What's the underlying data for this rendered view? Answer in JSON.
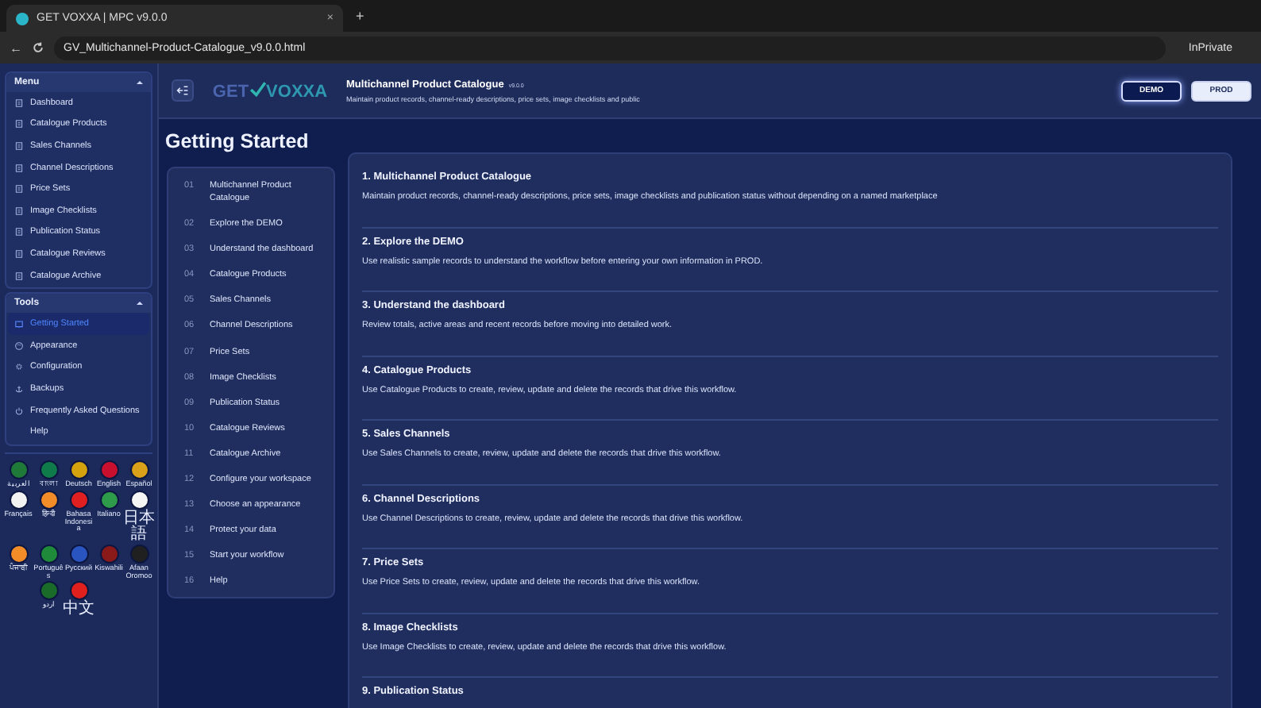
{
  "browser": {
    "tab_title": "GET VOXXA | MPC v9.0.0",
    "tab_close": "×",
    "new_tab": "+",
    "back": "←",
    "url": "GV_Multichannel-Product-Catalogue_v9.0.0.html",
    "profile": "InPrivate"
  },
  "sidebar": {
    "sections": [
      {
        "title": "Menu",
        "expanded": true,
        "items": [
          {
            "label": "Dashboard",
            "selected": false,
            "kind": "record"
          },
          {
            "label": "Catalogue Products",
            "selected": false,
            "kind": "record"
          },
          {
            "label": "Sales Channels",
            "selected": false,
            "kind": "record"
          },
          {
            "label": "Channel Descriptions",
            "selected": false,
            "kind": "record"
          },
          {
            "label": "Price Sets",
            "selected": false,
            "kind": "record"
          },
          {
            "label": "Image Checklists",
            "selected": false,
            "kind": "record"
          },
          {
            "label": "Publication Status",
            "selected": false,
            "kind": "record"
          },
          {
            "label": "Catalogue Reviews",
            "selected": false,
            "kind": "record"
          },
          {
            "label": "Catalogue Archive",
            "selected": false,
            "kind": "record"
          }
        ]
      },
      {
        "title": "Tools",
        "expanded": true,
        "items": [
          {
            "label": "Getting Started",
            "selected": true,
            "kind": "guide"
          },
          {
            "label": "Appearance",
            "selected": false,
            "kind": "appearance"
          },
          {
            "label": "Configuration",
            "selected": false,
            "kind": "configuration"
          },
          {
            "label": "Backups",
            "selected": false,
            "kind": "backup"
          },
          {
            "label": "Frequently Asked Questions",
            "selected": false,
            "kind": "faq"
          },
          {
            "label": "Help",
            "selected": false,
            "kind": "help"
          }
        ]
      }
    ],
    "languages": [
      {
        "label": "العربية",
        "color": "#1f7a3a"
      },
      {
        "label": "বাংলা",
        "color": "#0f7a4a"
      },
      {
        "label": "Deutsch",
        "color": "#d4a20c"
      },
      {
        "label": "English",
        "color": "#c8102e"
      },
      {
        "label": "Español",
        "color": "#d9a019"
      },
      {
        "label": "Français",
        "color": "#f2f2f2"
      },
      {
        "label": "हिन्दी",
        "color": "#f28c28"
      },
      {
        "label": "Bahasa Indonesia",
        "color": "#e02020"
      },
      {
        "label": "Italiano",
        "color": "#2e9b4a"
      },
      {
        "label": "日本語",
        "color": "#f5f5f5"
      },
      {
        "label": "ਪੰਜਾਬੀ",
        "color": "#f28c28"
      },
      {
        "label": "Português",
        "color": "#1f8a3a"
      },
      {
        "label": "Русский",
        "color": "#2a55c0"
      },
      {
        "label": "Kiswahili",
        "color": "#8a1a1a"
      },
      {
        "label": "Afaan Oromoo",
        "color": "#202020"
      },
      {
        "label": "اردو",
        "color": "#1a6a2a"
      },
      {
        "label": "中文",
        "color": "#e0201c"
      }
    ]
  },
  "header": {
    "logo_prefix": "GET",
    "logo_name": "VOXXA",
    "title": "Multichannel Product Catalogue",
    "version": "v9.0.0",
    "subtitle": "Maintain product records, channel-ready descriptions, price sets, image checklists and public",
    "modes": [
      {
        "label": "DEMO",
        "selected": true
      },
      {
        "label": "PROD",
        "selected": false
      }
    ]
  },
  "page_title": "Getting Started",
  "contents": [
    {
      "number": "01",
      "label": "Multichannel Product Catalogue"
    },
    {
      "number": "02",
      "label": "Explore the DEMO"
    },
    {
      "number": "03",
      "label": "Understand the dashboard"
    },
    {
      "number": "04",
      "label": "Catalogue Products"
    },
    {
      "number": "05",
      "label": "Sales Channels"
    },
    {
      "number": "06",
      "label": "Channel Descriptions"
    },
    {
      "number": "07",
      "label": "Price Sets"
    },
    {
      "number": "08",
      "label": "Image Checklists"
    },
    {
      "number": "09",
      "label": "Publication Status"
    },
    {
      "number": "10",
      "label": "Catalogue Reviews"
    },
    {
      "number": "11",
      "label": "Catalogue Archive"
    },
    {
      "number": "12",
      "label": "Configure your workspace"
    },
    {
      "number": "13",
      "label": "Choose an appearance"
    },
    {
      "number": "14",
      "label": "Protect your data"
    },
    {
      "number": "15",
      "label": "Start your workflow"
    },
    {
      "number": "16",
      "label": "Help"
    }
  ],
  "sections": [
    {
      "title": "1. Multichannel Product Catalogue",
      "text": "Maintain product records, channel-ready descriptions, price sets, image checklists and publication status without depending on a named marketplace"
    },
    {
      "title": "2. Explore the DEMO",
      "text": "Use realistic sample records to understand the workflow before entering your own information in PROD."
    },
    {
      "title": "3. Understand the dashboard",
      "text": "Review totals, active areas and recent records before moving into detailed work."
    },
    {
      "title": "4. Catalogue Products",
      "text": "Use Catalogue Products to create, review, update and delete the records that drive this workflow."
    },
    {
      "title": "5. Sales Channels",
      "text": "Use Sales Channels to create, review, update and delete the records that drive this workflow."
    },
    {
      "title": "6. Channel Descriptions",
      "text": "Use Channel Descriptions to create, review, update and delete the records that drive this workflow."
    },
    {
      "title": "7. Price Sets",
      "text": "Use Price Sets to create, review, update and delete the records that drive this workflow."
    },
    {
      "title": "8. Image Checklists",
      "text": "Use Image Checklists to create, review, update and delete the records that drive this workflow."
    },
    {
      "title": "9. Publication Status"
    }
  ]
}
